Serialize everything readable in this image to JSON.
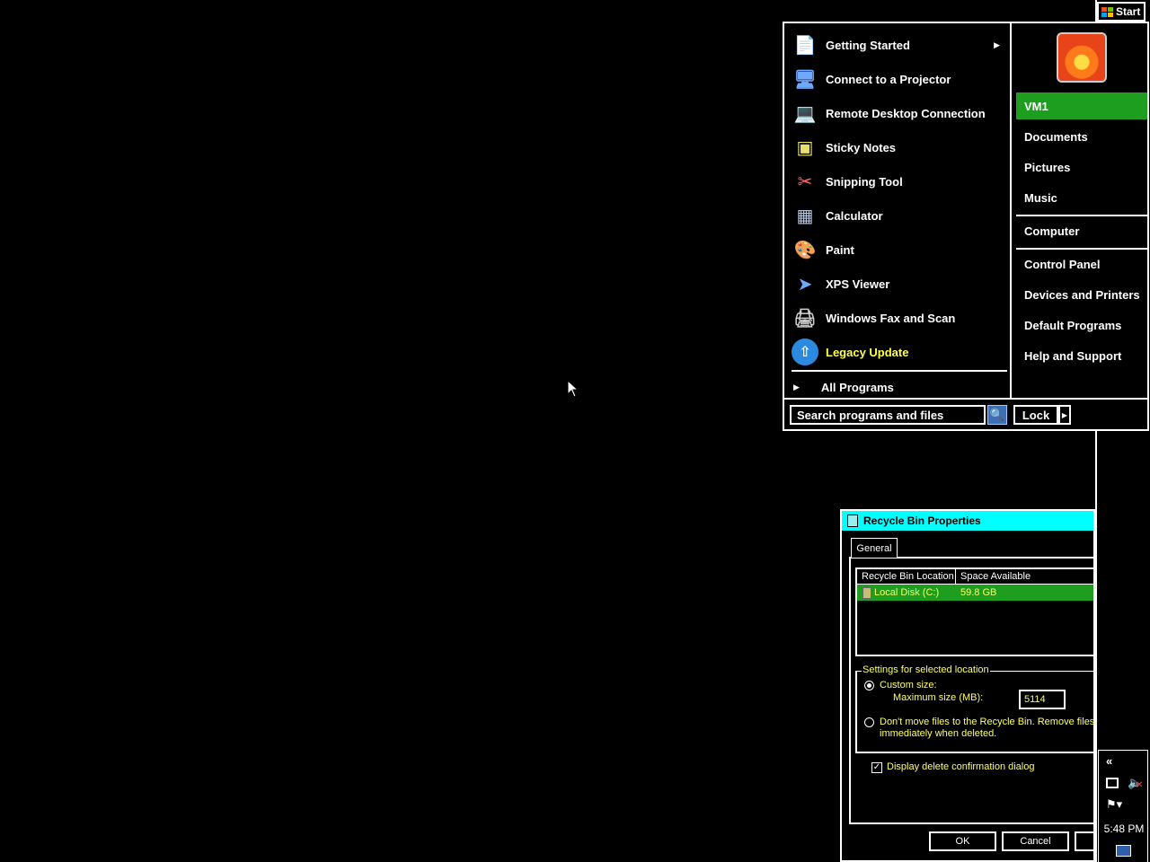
{
  "taskbar": {
    "start_label": "Start",
    "tray": {
      "expand_glyph": "«",
      "clock": "5:48 PM",
      "icons": [
        "network-icon",
        "volume-muted-icon",
        "action-center-flag-icon",
        "show-desktop-icon"
      ]
    }
  },
  "start_menu": {
    "programs": [
      {
        "label": "Getting Started",
        "icon": "getting-started-icon",
        "has_submenu": true
      },
      {
        "label": "Connect to a Projector",
        "icon": "projector-icon"
      },
      {
        "label": "Remote Desktop Connection",
        "icon": "remote-desktop-icon"
      },
      {
        "label": "Sticky Notes",
        "icon": "sticky-notes-icon"
      },
      {
        "label": "Snipping Tool",
        "icon": "snipping-tool-icon"
      },
      {
        "label": "Calculator",
        "icon": "calculator-icon"
      },
      {
        "label": "Paint",
        "icon": "paint-icon"
      },
      {
        "label": "XPS Viewer",
        "icon": "xps-viewer-icon"
      },
      {
        "label": "Windows Fax and Scan",
        "icon": "fax-scan-icon"
      },
      {
        "label": "Legacy Update",
        "icon": "legacy-update-icon",
        "highlight_color": "#ffff4d"
      }
    ],
    "all_programs": "All Programs",
    "places": {
      "user": "VM1",
      "documents": "Documents",
      "pictures": "Pictures",
      "music": "Music",
      "computer": "Computer",
      "control_panel": "Control Panel",
      "devices_printers": "Devices and Printers",
      "default_programs": "Default Programs",
      "help_support": "Help and Support"
    },
    "search_placeholder": "Search programs and files",
    "lock_label": "Lock",
    "selected_color": "#1e9e1e"
  },
  "dialog": {
    "title": "Recycle Bin Properties",
    "tab": "General",
    "columns": [
      "Recycle Bin Location",
      "Space Available"
    ],
    "rows": [
      {
        "location": "Local Disk (C:)",
        "space": "59.8 GB"
      }
    ],
    "group_title": "Settings for selected location",
    "custom_size_label": "Custom size:",
    "max_size_label": "Maximum size (MB):",
    "max_size_value": "5114",
    "no_move_line1": "Don't move files to the Recycle Bin. Remove files",
    "no_move_line2": "immediately when deleted.",
    "confirm_label": "Display delete confirmation dialog",
    "confirm_checked": true,
    "ok": "OK",
    "cancel": "Cancel",
    "titlebar_color": "#00ffff",
    "text_color": "#ffff66"
  }
}
